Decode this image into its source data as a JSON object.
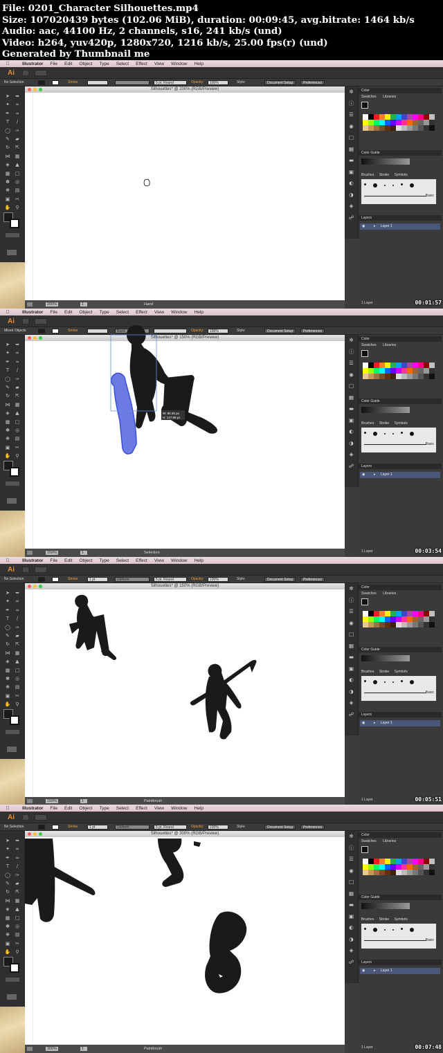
{
  "header": {
    "line_file": "File: 0201_Character Silhouettes.mp4",
    "line_size": "Size: 107020439 bytes (102.06 MiB), duration: 00:09:45, avg.bitrate: 1464 kb/s",
    "line_audio": "Audio: aac, 44100 Hz, 2 channels, s16, 241 kb/s (und)",
    "line_video": "Video: h264, yuv420p, 1280x720, 1216 kb/s, 25.00 fps(r) (und)",
    "line_gen": "Generated by Thumbnail me"
  },
  "menu": {
    "apple": "",
    "app": "Illustrator",
    "items": [
      "File",
      "Edit",
      "Object",
      "Type",
      "Select",
      "Effect",
      "View",
      "Window",
      "Help"
    ]
  },
  "app": {
    "logo": "Ai"
  },
  "controls": {
    "stroke": "Stroke",
    "opacity": "Opacity:",
    "opacity_value": "100%",
    "style": "Style:",
    "document_setup": "Document Setup",
    "preferences": "Preferences"
  },
  "panels": {
    "color": "Color",
    "swatches": "Swatches",
    "libraries": "Libraries",
    "color_guide": "Color Guide",
    "brushes": "Brushes",
    "stroke": "Stroke",
    "symbols": "Symbols",
    "basic": "Basic",
    "layers": "Layers",
    "layer_name": "Layer 1",
    "layer_count": "1 Layer"
  },
  "frames": [
    {
      "selection": "No Selection",
      "stroke_weight": "",
      "stroke_profile": "",
      "brush": "5 pt. Round",
      "title": "Silhouettes* @ 200% (RGB/Preview)",
      "zoom": "200%",
      "page": "1",
      "tool": "Hand",
      "timestamp": "00:01:57"
    },
    {
      "selection": "Mixed Objects",
      "stroke_weight": "",
      "stroke_profile": "Basic",
      "brush": "",
      "title": "Silhouettes* @ 150% (RGB/Preview)",
      "zoom": "150%",
      "page": "1",
      "tool": "Selection",
      "timestamp": "00:03:54",
      "tooltip_w": "W: 80.45 px",
      "tooltip_h": "H: 147.88 px"
    },
    {
      "selection": "No Selection",
      "stroke_weight": "1 pt",
      "stroke_profile": "Uniform",
      "brush": "5 pt. Round",
      "title": "Silhouettes* @ 150% (RGB/Preview)",
      "zoom": "150%",
      "page": "1",
      "tool": "Paintbrush",
      "timestamp": "00:05:51"
    },
    {
      "selection": "No Selection",
      "stroke_weight": "1 pt",
      "stroke_profile": "Uniform",
      "brush": "5 pt. Round",
      "title": "Silhouettes* @ 300% (RGB/Preview)",
      "zoom": "300%",
      "page": "1",
      "tool": "Paintbrush",
      "timestamp": "00:07:48"
    }
  ],
  "colors": {
    "canvas": "#ffffff",
    "silhouette": "#1a1a1a",
    "selection_blue": "#3a4fd9",
    "menu_pink": "#e6cfd7",
    "orange_label": "#f0a040",
    "timestamp": "#ffffff"
  },
  "icons": [
    "apple-icon",
    "hand-cursor-icon",
    "selection-tool-icon",
    "paintbrush-icon",
    "eye-icon",
    "layer-arrow-icon"
  ]
}
